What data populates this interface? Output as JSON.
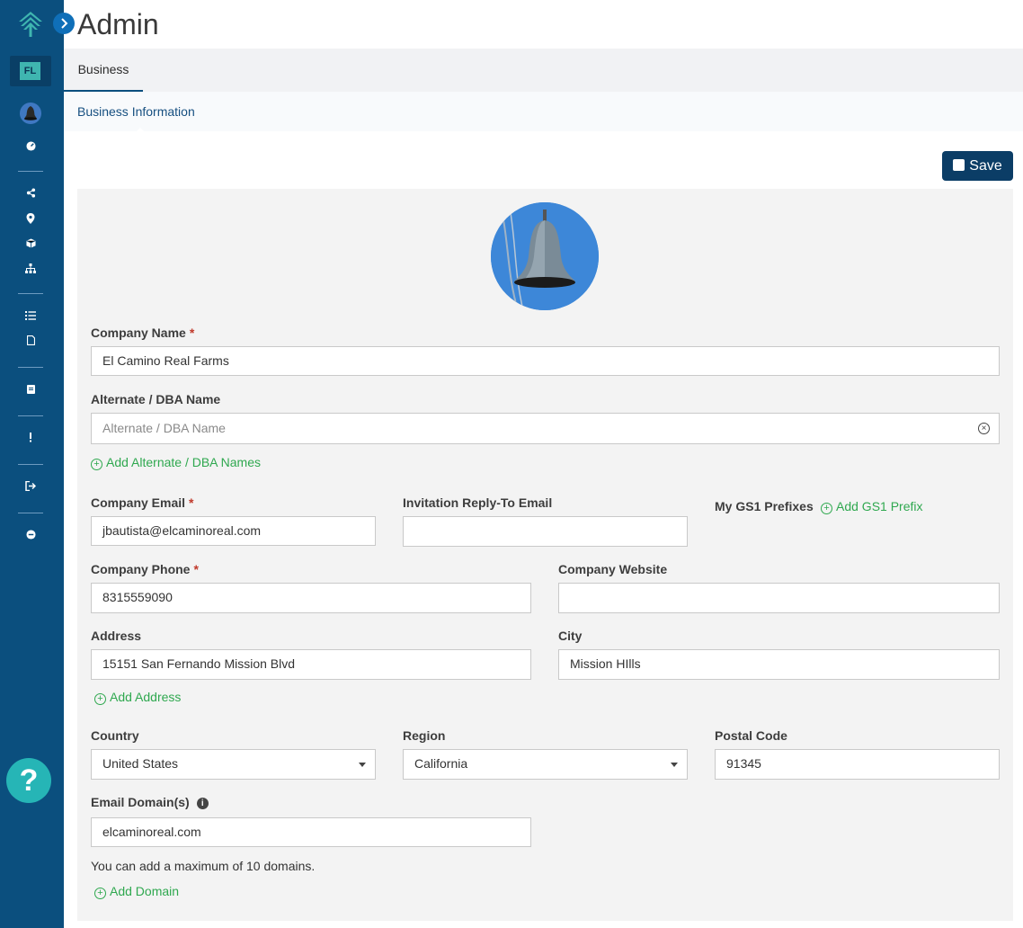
{
  "app": {
    "page_title": "Admin",
    "org_initials": "FL"
  },
  "tabs": {
    "business": "Business"
  },
  "subtabs": {
    "business_information": "Business Information"
  },
  "toolbar": {
    "save_label": "Save"
  },
  "form": {
    "company_name": {
      "label": "Company Name",
      "required": "*",
      "value": "El Camino Real Farms"
    },
    "dba_name": {
      "label": "Alternate / DBA Name",
      "placeholder": "Alternate / DBA Name",
      "add_label": "Add Alternate / DBA Names"
    },
    "company_email": {
      "label": "Company Email",
      "required": "*",
      "value": "jbautista@elcaminoreal.com"
    },
    "reply_to_email": {
      "label": "Invitation Reply-To Email",
      "value": ""
    },
    "gs1": {
      "label": "My GS1 Prefixes",
      "add_label": "Add GS1 Prefix"
    },
    "company_phone": {
      "label": "Company Phone",
      "required": "*",
      "value": "8315559090"
    },
    "company_website": {
      "label": "Company Website",
      "value": ""
    },
    "address": {
      "label": "Address",
      "value": "15151 San Fernando Mission Blvd",
      "add_label": "Add Address"
    },
    "city": {
      "label": "City",
      "value": "Mission HIlls"
    },
    "country": {
      "label": "Country",
      "value": "United States"
    },
    "region": {
      "label": "Region",
      "value": "California"
    },
    "postal_code": {
      "label": "Postal Code",
      "value": "91345"
    },
    "email_domains": {
      "label": "Email Domain(s)",
      "value": "elcaminoreal.com",
      "hint": "You can add a maximum of 10 domains.",
      "add_label": "Add Domain"
    }
  },
  "help": {
    "label": "?"
  },
  "icons": {
    "sidebar": [
      "logo-icon",
      "dashboard-icon",
      "share-icon",
      "location-pin-icon",
      "cube-icon",
      "sitemap-icon",
      "list-icon",
      "document-icon",
      "clipboard-icon",
      "alert-icon",
      "sign-out-icon",
      "minus-circle-icon"
    ]
  },
  "colors": {
    "sidebar": "#0b4f7e",
    "accent_green": "#2fa84f",
    "save_button": "#0b3d66",
    "help_button": "#26b5b6"
  }
}
